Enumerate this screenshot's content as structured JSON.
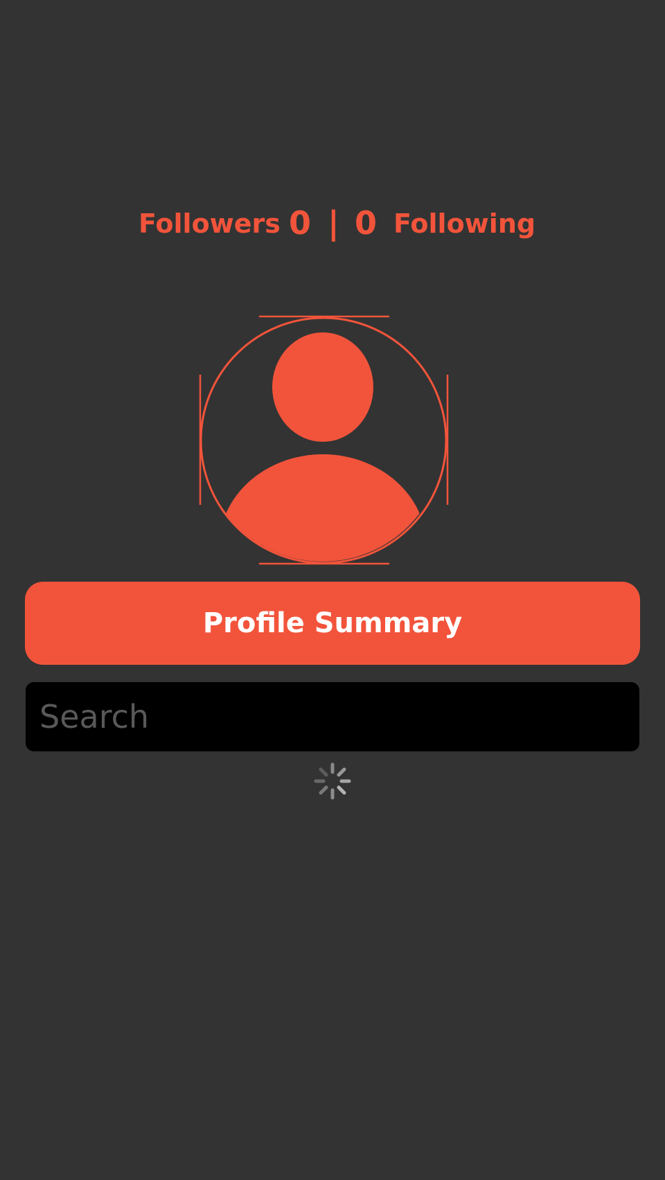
{
  "stats": {
    "followers_label": "Followers",
    "followers_count": "0",
    "separator": "|",
    "following_count": "0",
    "following_label": "Following"
  },
  "avatar": {
    "icon": "user-profile-icon"
  },
  "profile_button": {
    "label": "Profile Summary"
  },
  "search": {
    "placeholder": "Search",
    "value": ""
  },
  "loading": {
    "icon": "activity-spinner-icon"
  },
  "colors": {
    "background": "#333333",
    "accent": "#F2543B",
    "search_background": "#000000",
    "placeholder": "#595959"
  }
}
